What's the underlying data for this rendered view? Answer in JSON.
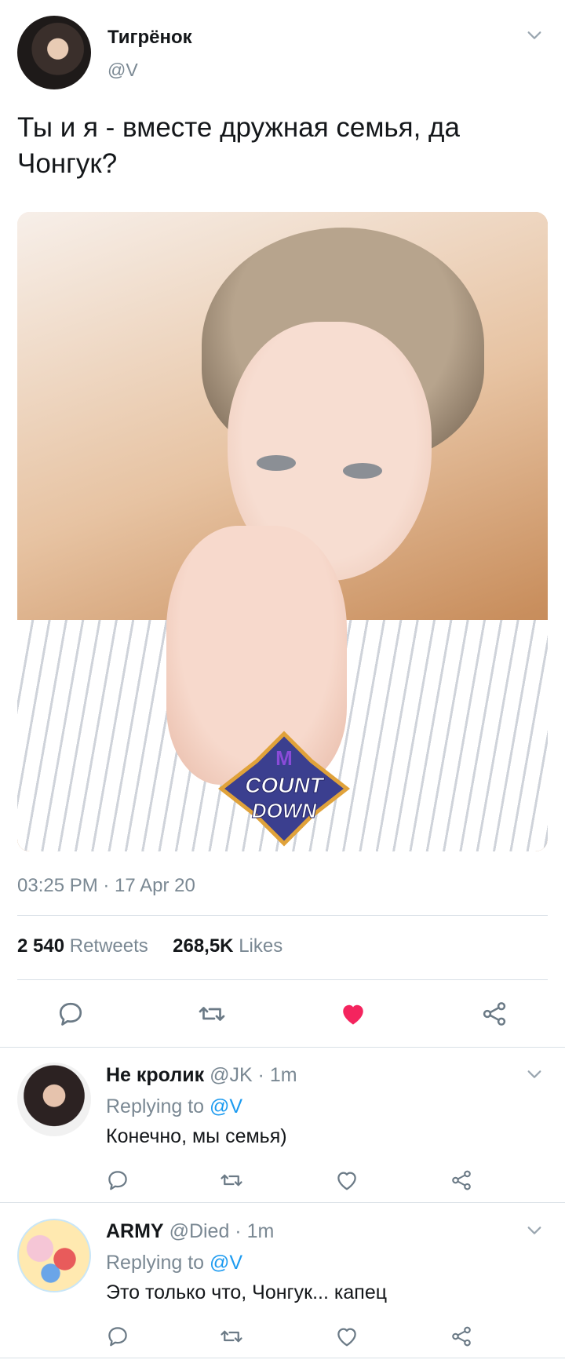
{
  "tweet": {
    "author_name": "Тигрёнок",
    "author_handle": "@V",
    "text": "Ты и я - вместе дружная семья, да Чонгук?",
    "media_logo_text_top": "COUNT",
    "media_logo_text_bottom": "DOWN",
    "media_logo_letter": "M",
    "timestamp": "03:25 PM · 17 Apr 20",
    "retweets_count": "2 540",
    "retweets_label": "Retweets",
    "likes_count": "268,5K",
    "likes_label": "Likes",
    "liked": true
  },
  "replies": [
    {
      "name": "Не кролик",
      "handle": "@JK · 1m",
      "replying_prefix": "Replying to",
      "replying_mention": "@V",
      "text": "Конечно, мы семья)"
    },
    {
      "name": "ARMY",
      "handle": "@Died · 1m",
      "replying_prefix": "Replying to",
      "replying_mention": "@V",
      "text": "Это только что, Чонгук... капец"
    }
  ],
  "icons": {
    "reply": "reply-icon",
    "retweet": "retweet-icon",
    "like": "heart-icon",
    "share": "share-icon",
    "more": "chevron-down-icon"
  },
  "colors": {
    "like_active": "#f4245e",
    "mention": "#1d9bf0",
    "muted": "#7a8893"
  }
}
